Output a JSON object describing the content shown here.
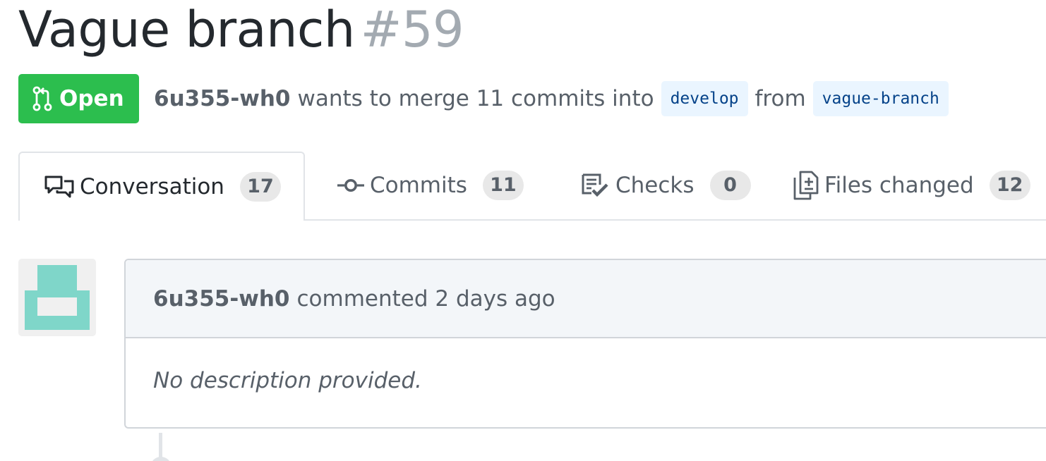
{
  "pull_request": {
    "title": "Vague branch",
    "number": "#59"
  },
  "state": {
    "label": "Open",
    "icon": "git-pull-request-icon",
    "color": "#2cbe4e"
  },
  "meta": {
    "author": "6u355-wh0",
    "text_before": "wants to merge 11 commits into",
    "base_branch": "develop",
    "text_from": "from",
    "head_branch": "vague-branch"
  },
  "tabs": [
    {
      "label": "Conversation",
      "count": "17",
      "icon": "comment-discussion-icon",
      "selected": true
    },
    {
      "label": "Commits",
      "count": "11",
      "icon": "git-commit-icon",
      "selected": false
    },
    {
      "label": "Checks",
      "count": "0",
      "icon": "checklist-icon",
      "selected": false
    },
    {
      "label": "Files changed",
      "count": "12",
      "icon": "diff-icon",
      "selected": false
    }
  ],
  "comment": {
    "author": "6u355-wh0",
    "action": "commented 2 days ago",
    "body": "No description provided."
  },
  "colors": {
    "avatar": "#7fd6c9",
    "header_bg": "#f3f6f9",
    "branch_bg": "#eaf5ff"
  }
}
